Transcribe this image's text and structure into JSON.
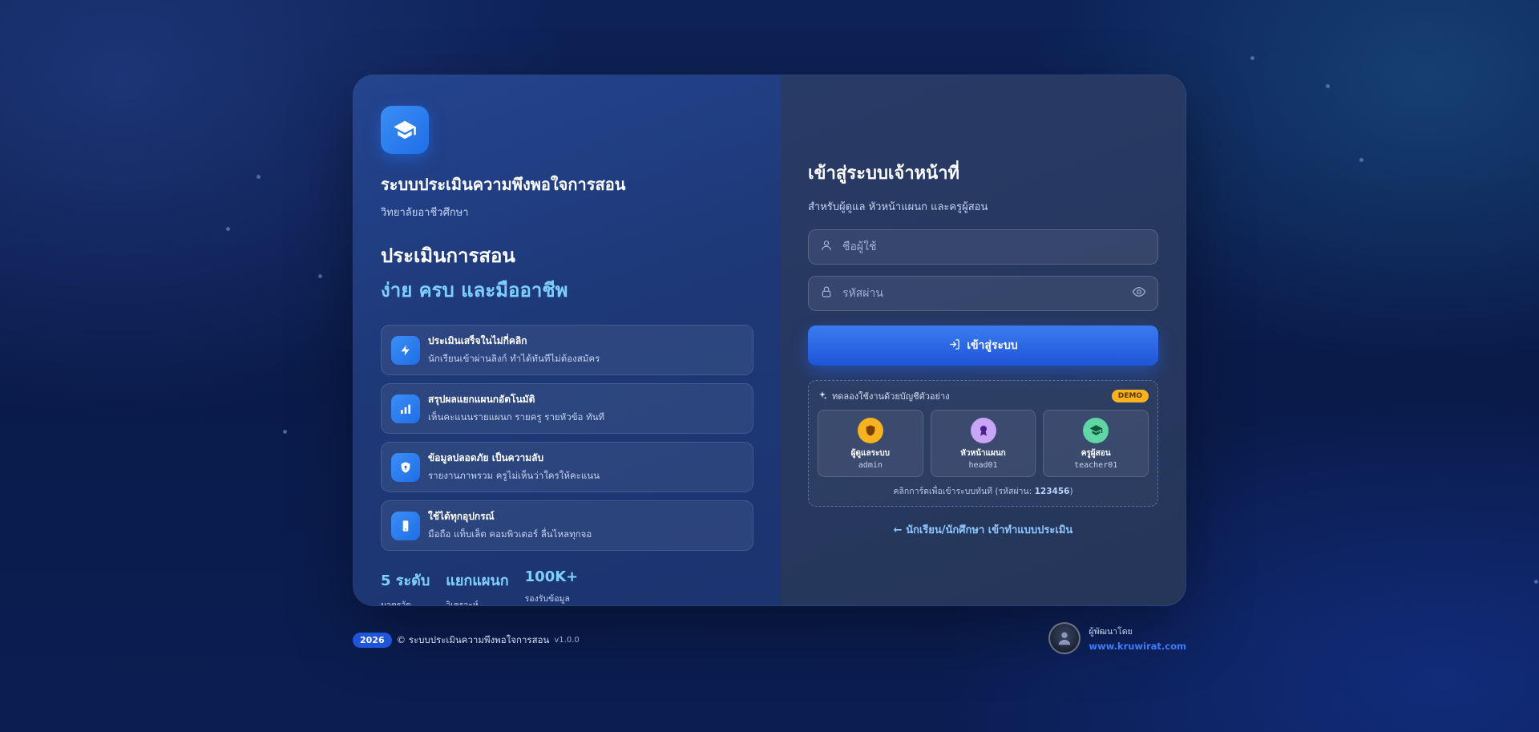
{
  "brand": {
    "logo_icon": "graduation-cap-icon",
    "title": "ระบบประเมินความพึงพอใจการสอน",
    "subtitle": "วิทยาลัยอาชีวศึกษา"
  },
  "hero": {
    "line1": "ประเมินการสอน",
    "line2": "ง่าย ครบ และมืออาชีพ"
  },
  "features": [
    {
      "icon": "lightning-icon",
      "title": "ประเมินเสร็จในไม่กี่คลิก",
      "desc": "นักเรียนเข้าผ่านลิงก์ ทำได้ทันทีไม่ต้องสมัคร"
    },
    {
      "icon": "bar-chart-icon",
      "title": "สรุปผลแยกแผนกอัตโนมัติ",
      "desc": "เห็นคะแนนรายแผนก รายครู รายหัวข้อ ทันที"
    },
    {
      "icon": "shield-icon",
      "title": "ข้อมูลปลอดภัย เป็นความลับ",
      "desc": "รายงานภาพรวม ครูไม่เห็นว่าใครให้คะแนน"
    },
    {
      "icon": "mobile-icon",
      "title": "ใช้ได้ทุกอุปกรณ์",
      "desc": "มือถือ แท็บเล็ต คอมพิวเตอร์ ลื่นไหลทุกจอ"
    }
  ],
  "stats": [
    {
      "value": "5 ระดับ",
      "label": "มาตรวัด"
    },
    {
      "value": "แยกแผนก",
      "label": "วิเคราะห์"
    },
    {
      "value": "100K+",
      "label": "รองรับข้อมูล"
    }
  ],
  "login": {
    "title": "เข้าสู่ระบบเจ้าหน้าที่",
    "subtitle": "สำหรับผู้ดูแล หัวหน้าแผนก และครูผู้สอน",
    "username_placeholder": "ชื่อผู้ใช้",
    "username_value": "",
    "password_placeholder": "รหัสผ่าน",
    "password_value": "",
    "submit_label": "เข้าสู่ระบบ"
  },
  "demo": {
    "heading": "ทดลองใช้งานด้วยบัญชีตัวอย่าง",
    "badge": "DEMO",
    "accounts": [
      {
        "role": "ผู้ดูแลระบบ",
        "username": "admin",
        "icon": "shield-icon",
        "color": "#f6b21f"
      },
      {
        "role": "หัวหน้าแผนก",
        "username": "head01",
        "icon": "award-icon",
        "color": "#c9a5f5"
      },
      {
        "role": "ครูผู้สอน",
        "username": "teacher01",
        "icon": "graduation-cap-icon",
        "color": "#5fd6a4"
      }
    ],
    "hint_prefix": "คลิกการ์ดเพื่อเข้าระบบทันที (รหัสผ่าน: ",
    "hint_password": "123456",
    "hint_suffix": ")"
  },
  "student_link": "← นักเรียน/นักศึกษา เข้าทำแบบประเมิน",
  "footer": {
    "year": "2026",
    "copyright": "© ระบบประเมินความพึงพอใจการสอน",
    "version": "v1.0.0",
    "developer_label": "ผู้พัฒนาโดย",
    "developer_link": "www.kruwirat.com"
  }
}
